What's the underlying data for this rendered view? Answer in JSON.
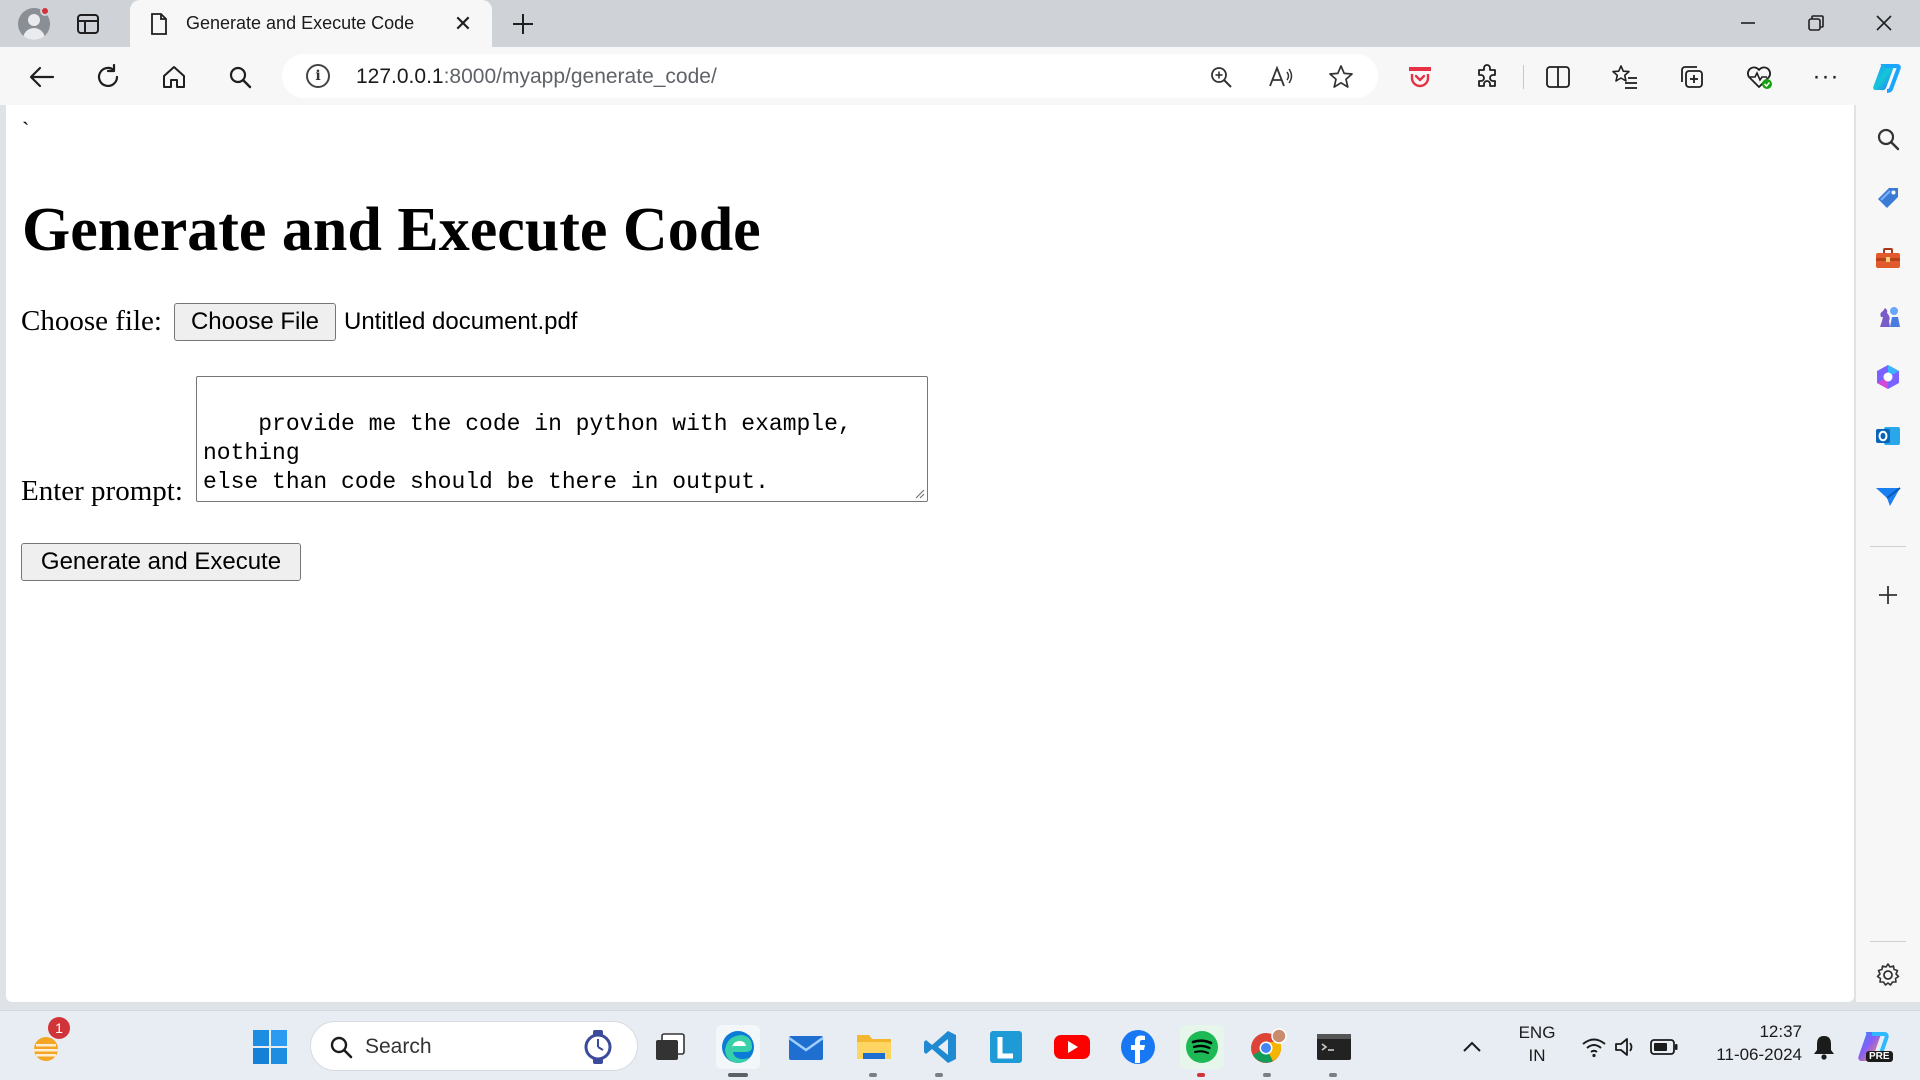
{
  "browser": {
    "tab_title": "Generate and Execute Code",
    "url_host": "127.0.0.1",
    "url_path": ":8000/myapp/generate_code/"
  },
  "page": {
    "stray_char": "`",
    "heading": "Generate and Execute Code",
    "choose_file_label": "Choose file:",
    "choose_file_button": "Choose File",
    "chosen_file_name": "Untitled document.pdf",
    "prompt_label": "Enter prompt:",
    "prompt_value": "provide me the code in python with example, nothing\nelse than code should be there in output.",
    "submit_button": "Generate and Execute"
  },
  "taskbar": {
    "weather_badge": "1",
    "search_placeholder": "Search",
    "lang_line1": "ENG",
    "lang_line2": "IN",
    "time": "12:37",
    "date": "11-06-2024",
    "copilot_badge": "PRE"
  },
  "colors": {
    "edge_blue": "#0c7bd8",
    "spotify_green": "#1db954",
    "youtube_red": "#ff0000",
    "facebook_blue": "#1877f2",
    "notification_red": "#d13438"
  }
}
